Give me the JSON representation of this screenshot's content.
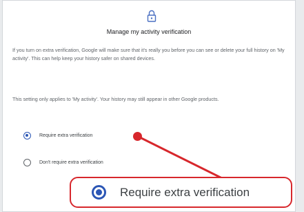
{
  "dialog": {
    "title": "Manage my activity verification",
    "paragraph1": "If you turn on extra verification, Google will make sure that it's really you before you can see or delete your full history on 'My activity'. This can help keep your history safer on shared devices.",
    "paragraph2": "This setting only applies to 'My activity'. Your history may still appear in other Google products.",
    "lock_icon": "lock-icon"
  },
  "options": [
    {
      "label": "Require extra verification",
      "selected": true
    },
    {
      "label": "Don't require extra verification",
      "selected": false
    }
  ],
  "callout": {
    "label": "Require extra verification",
    "selected": true
  },
  "colors": {
    "accent": "#2b56b5",
    "annotation": "#d7272c"
  }
}
